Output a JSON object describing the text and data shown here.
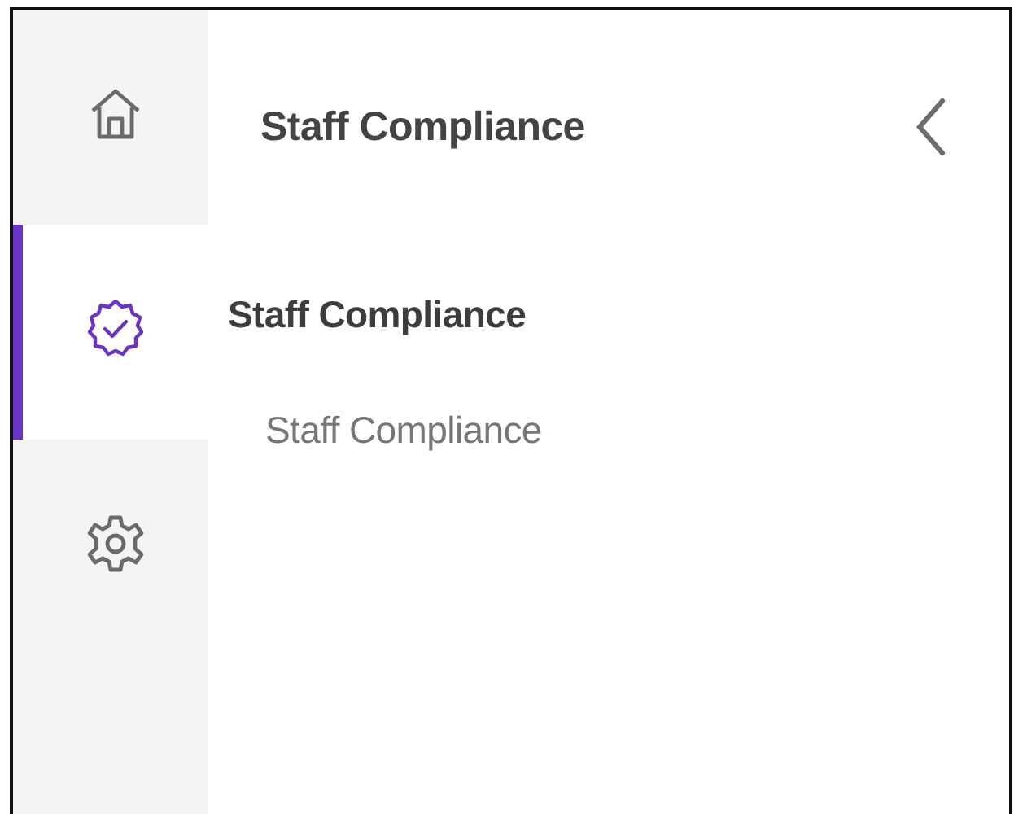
{
  "rail": [
    {
      "kind": "home",
      "selected": false
    },
    {
      "kind": "compliance",
      "selected": true
    },
    {
      "kind": "settings",
      "selected": false
    }
  ],
  "panel": {
    "title": "Staff Compliance",
    "sections": [
      {
        "label": "Staff Compliance",
        "items": [
          {
            "label": "Staff Compliance"
          }
        ]
      }
    ]
  }
}
